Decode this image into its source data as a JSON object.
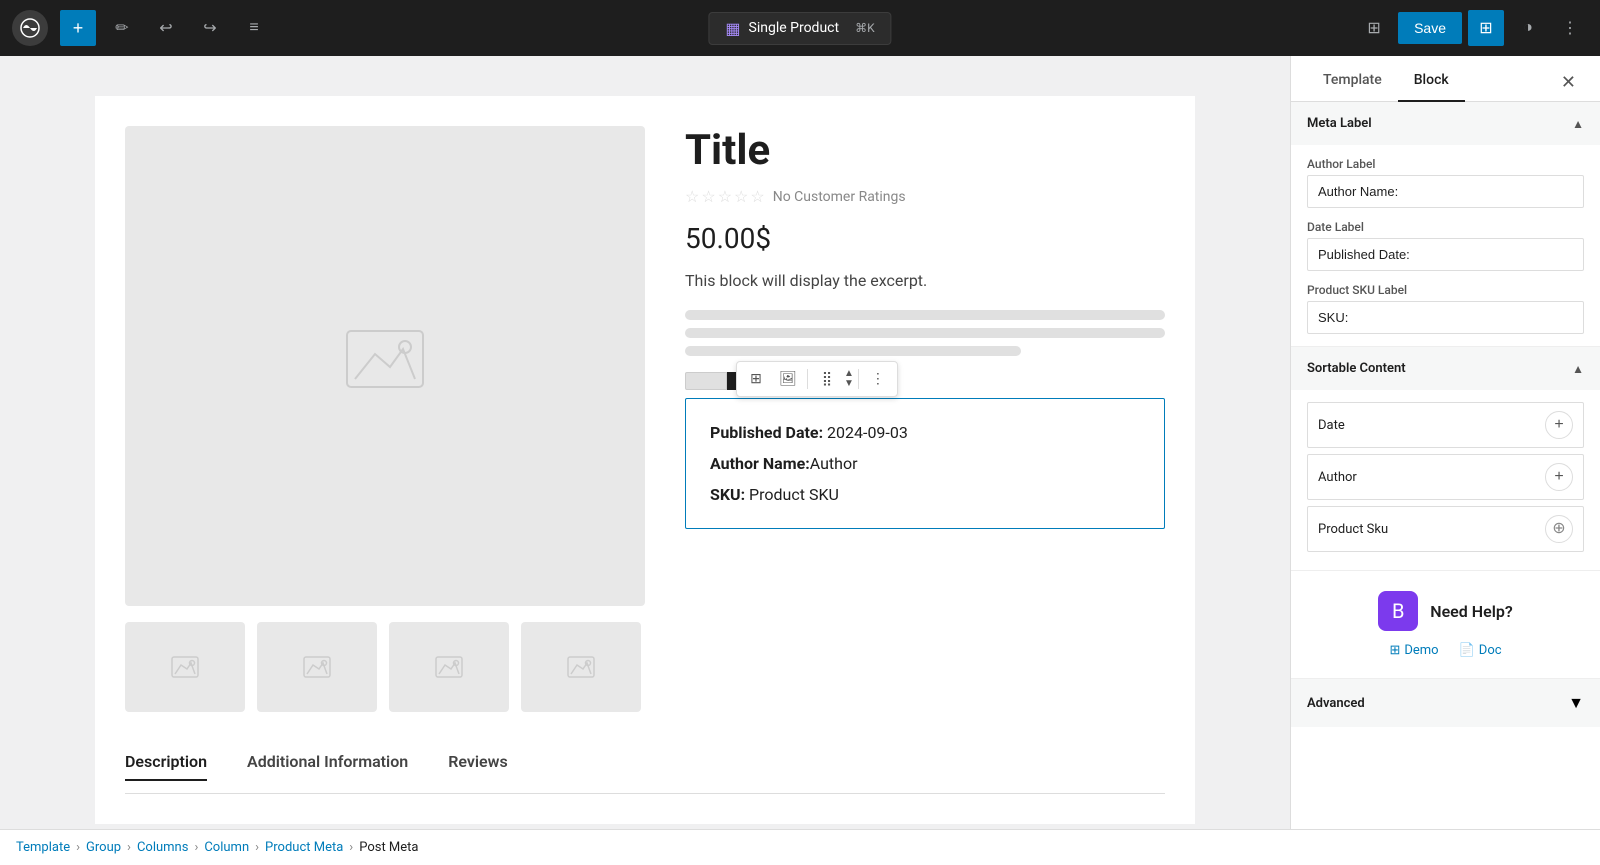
{
  "topbar": {
    "logo_alt": "WordPress",
    "add_label": "+",
    "tool_label": "✏",
    "undo_label": "↩",
    "redo_label": "↪",
    "list_label": "≡",
    "template_badge": {
      "icon": "▦",
      "label": "Single Product",
      "shortcut": "⌘K"
    },
    "save_label": "Save",
    "layout_icon": "⊞",
    "theme_icon": "◑",
    "more_icon": "⋮"
  },
  "panel": {
    "tab_template": "Template",
    "tab_block": "Block",
    "close_icon": "✕",
    "meta_label_section": {
      "title": "Meta Label",
      "author_label_field": "Author Label",
      "author_label_value": "Author Name:",
      "date_label_field": "Date Label",
      "date_label_value": "Published Date:",
      "sku_label_field": "Product SKU Label",
      "sku_label_value": "SKU:"
    },
    "sortable_section": {
      "title": "Sortable Content",
      "items": [
        {
          "label": "Date"
        },
        {
          "label": "Author"
        },
        {
          "label": "Product Sku"
        }
      ]
    },
    "help": {
      "icon": "B",
      "title": "Need Help?",
      "demo_label": "Demo",
      "doc_label": "Doc"
    },
    "advanced": {
      "title": "Advanced",
      "chevron": "▼"
    }
  },
  "product": {
    "title": "Title",
    "rating_text": "No Customer Ratings",
    "price": "50.00$",
    "excerpt": "This block will display the excerpt.",
    "published_date_label": "Published Date:",
    "published_date_value": "2024-09-03",
    "author_label": "Author Name:",
    "author_value": "Author",
    "sku_label": "SKU:",
    "sku_value": "Product SKU",
    "tabs": [
      {
        "label": "Description"
      },
      {
        "label": "Additional Information"
      },
      {
        "label": "Reviews"
      }
    ]
  },
  "breadcrumb": {
    "items": [
      {
        "label": "Template"
      },
      {
        "label": "Group"
      },
      {
        "label": "Columns"
      },
      {
        "label": "Column"
      },
      {
        "label": "Product Meta"
      },
      {
        "label": "Post Meta"
      }
    ]
  }
}
